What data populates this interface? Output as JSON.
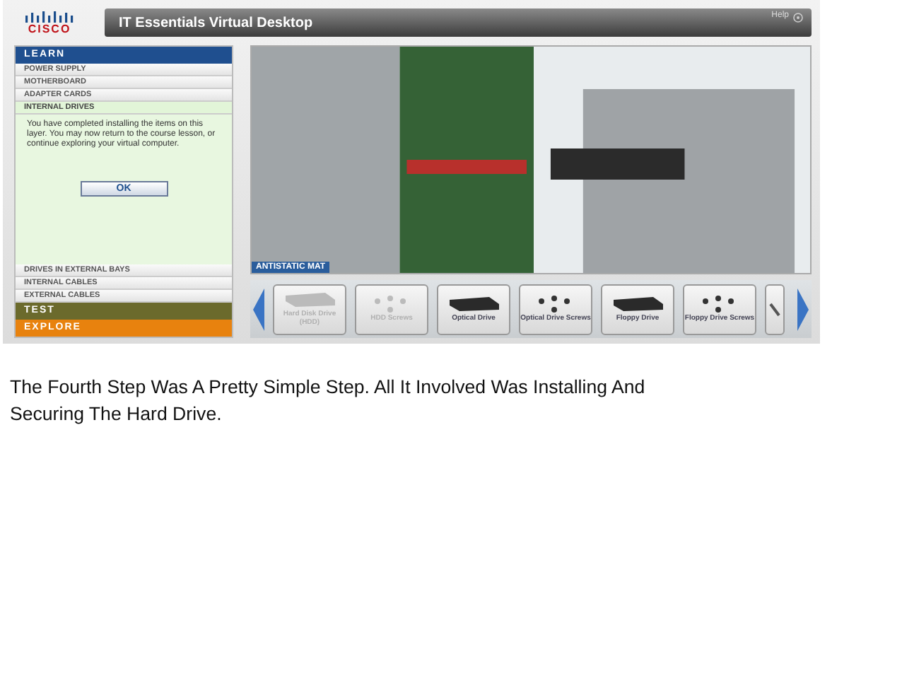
{
  "logo": {
    "text": "CISCO"
  },
  "window": {
    "title": "IT Essentials Virtual Desktop",
    "help": "Help"
  },
  "sidebar": {
    "sections": [
      {
        "label": "LEARN",
        "color": "#1f4f8f",
        "items": [
          {
            "label": "POWER SUPPLY",
            "selected": false
          },
          {
            "label": "MOTHERBOARD",
            "selected": false
          },
          {
            "label": "ADAPTER CARDS",
            "selected": false
          },
          {
            "label": "INTERNAL DRIVES",
            "selected": true
          },
          {
            "label": "DRIVES IN EXTERNAL BAYS",
            "selected": false
          },
          {
            "label": "INTERNAL CABLES",
            "selected": false
          },
          {
            "label": "EXTERNAL CABLES",
            "selected": false
          }
        ]
      },
      {
        "label": "TEST",
        "color": "#6b6a2c"
      },
      {
        "label": "EXPLORE",
        "color": "#e8820e"
      }
    ],
    "message": "You have completed installing the items on this layer. You may now return to the course lesson, or continue exploring your virtual computer.",
    "button": "OK"
  },
  "viewer": {
    "mat_label": "ANTISTATIC MAT"
  },
  "parts": [
    {
      "label": "Hard Disk Drive (HDD)",
      "kind": "drive",
      "disabled": true
    },
    {
      "label": "HDD Screws",
      "kind": "screws",
      "disabled": true
    },
    {
      "label": "Optical Drive",
      "kind": "drive",
      "disabled": false
    },
    {
      "label": "Optical Drive Screws",
      "kind": "screws",
      "disabled": false
    },
    {
      "label": "Floppy Drive",
      "kind": "drive",
      "disabled": false
    },
    {
      "label": "Floppy Drive Screws",
      "kind": "screws",
      "disabled": false
    }
  ],
  "caption": "The Fourth Step Was A Pretty Simple Step. All It Involved Was Installing And Securing The Hard Drive."
}
